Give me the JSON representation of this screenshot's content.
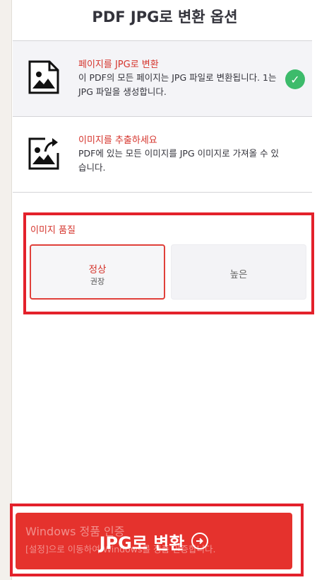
{
  "panel": {
    "title": "PDF JPG로 변환 옵션"
  },
  "options": [
    {
      "title": "페이지를 JPG로 변환",
      "description": "이 PDF의 모든 페이지는 JPG 파일로 변환됩니다. 1는 JPG 파일을 생성합니다.",
      "icon": "image-page-icon",
      "selected": true
    },
    {
      "title": "이미지를 추출하세요",
      "description": "PDF에 있는 모든 이미지를 JPG 이미지로 가져올 수 있습니다.",
      "icon": "image-export-icon",
      "selected": false
    }
  ],
  "quality": {
    "label": "이미지 품질",
    "normal_label": "정상",
    "normal_sub": "권장",
    "high_label": "높은",
    "selected": "정상"
  },
  "convert": {
    "label": "JPG로 변환",
    "icon": "arrow-right-circle-icon"
  },
  "watermark": {
    "title": "Windows 정품 인증",
    "subtitle": "[설정]으로 이동하여 Windows를 정품 인증합니다."
  },
  "colors": {
    "accent": "#e5322d",
    "highlight_border": "#e3212b",
    "check": "#3dbb6b"
  }
}
